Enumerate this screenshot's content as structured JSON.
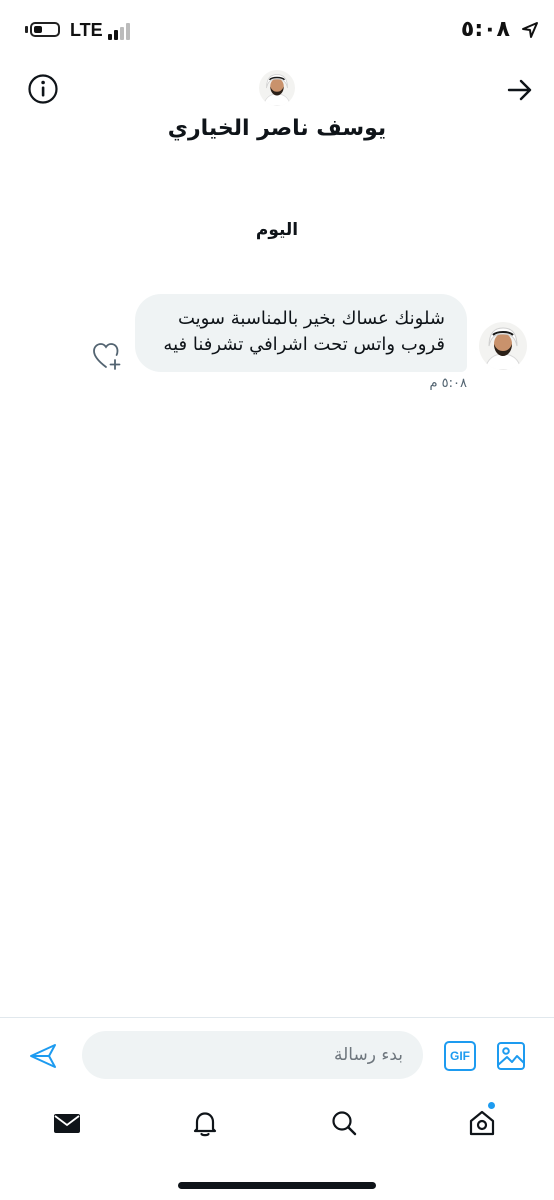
{
  "status_bar": {
    "network": "LTE",
    "time": "٥:٠٨",
    "battery_level": 0.3
  },
  "header": {
    "contact_name": "يوسف ناصر الخياري",
    "icons": {
      "info": "info-icon",
      "back": "arrow-right-icon"
    }
  },
  "conversation": {
    "date_divider": "اليوم",
    "messages": [
      {
        "lines": [
          "شلونك عساك بخير بالمناسبة سويت",
          "قروب واتس تحت اشرافي تشرفنا فيه"
        ],
        "time": "٥:٠٨ م"
      }
    ]
  },
  "composer": {
    "placeholder": "بدء رسالة",
    "gif_label": "GIF",
    "colors": {
      "accent": "#1d9bf0",
      "input_bg": "#eff3f4"
    }
  },
  "tabbar": {
    "items": [
      "home-icon",
      "search-icon",
      "notifications-bell-icon",
      "messages-envelope-icon"
    ]
  }
}
